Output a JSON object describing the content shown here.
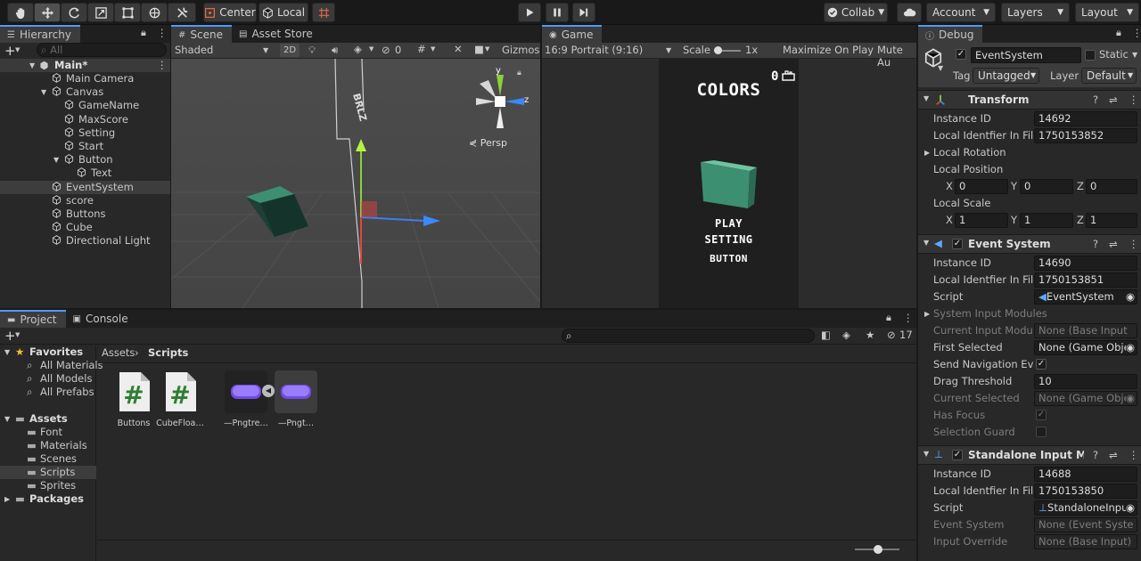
{
  "toolbar": {
    "center_label": "Center",
    "local_label": "Local",
    "collab_label": "Collab",
    "account_label": "Account",
    "layers_label": "Layers",
    "layout_label": "Layout"
  },
  "hierarchy": {
    "tab_label": "Hierarchy",
    "search_placeholder": "All",
    "scene_name": "Main*",
    "items": [
      {
        "label": "Main Camera"
      },
      {
        "label": "Canvas"
      },
      {
        "label": "GameName"
      },
      {
        "label": "MaxScore"
      },
      {
        "label": "Setting"
      },
      {
        "label": "Start"
      },
      {
        "label": "Button"
      },
      {
        "label": "Text"
      },
      {
        "label": "EventSystem"
      },
      {
        "label": "score"
      },
      {
        "label": "Buttons"
      },
      {
        "label": "Cube"
      },
      {
        "label": "Directional Light"
      }
    ]
  },
  "scene": {
    "tab_label": "Scene",
    "asset_store_tab": "Asset Store",
    "shading_mode": "Shaded",
    "mode_2d": "2D",
    "hidden_count": "0",
    "gizmos_label": "Gizmos",
    "persp_label": "Persp",
    "axis_y": "y",
    "axis_z": "z"
  },
  "game": {
    "tab_label": "Game",
    "aspect": "16:9 Portrait (9:16)",
    "scale_label": "Scale",
    "scale_value": "1x",
    "maximize_label": "Maximize On Play",
    "mute_label": "Mute Au",
    "title": "COLORS",
    "score": "0",
    "menu": [
      "PLAY",
      "SETTING",
      "BUTTON"
    ]
  },
  "inspector": {
    "tab_label": "Debug",
    "object_name": "EventSystem",
    "static_label": "Static",
    "tag_label": "Tag",
    "tag_value": "Untagged",
    "layer_label": "Layer",
    "layer_value": "Default",
    "transform": {
      "title": "Transform",
      "instance_id_label": "Instance ID",
      "instance_id": "14692",
      "local_id_label": "Local Identfier In File",
      "local_id": "1750153852",
      "local_rotation_label": "Local Rotation",
      "local_position_label": "Local Position",
      "local_scale_label": "Local Scale",
      "pos_x": "0",
      "pos_y": "0",
      "pos_z": "0",
      "scale_x": "1",
      "scale_y": "1",
      "scale_z": "1",
      "x_label": "X",
      "y_label": "Y",
      "z_label": "Z"
    },
    "event_system": {
      "title": "Event System",
      "instance_id_label": "Instance ID",
      "instance_id": "14690",
      "local_id_label": "Local Identfier In File",
      "local_id": "1750153851",
      "script_label": "Script",
      "script_value": "EventSystem",
      "system_input_label": "System Input Modules",
      "current_input_label": "Current Input Module",
      "current_input_value": "None (Base Input",
      "first_selected_label": "First Selected",
      "first_selected_value": "None (Game Obje",
      "send_nav_label": "Send Navigation Even",
      "drag_threshold_label": "Drag Threshold",
      "drag_threshold_value": "10",
      "current_selected_label": "Current Selected",
      "current_selected_value": "None (Game Obje",
      "has_focus_label": "Has Focus",
      "selection_guard_label": "Selection Guard"
    },
    "standalone": {
      "title": "Standalone Input Module",
      "instance_id_label": "Instance ID",
      "instance_id": "14688",
      "local_id_label": "Local Identfier In File",
      "local_id": "1750153850",
      "script_label": "Script",
      "script_value": "StandaloneInpu",
      "event_system_label": "Event System",
      "event_system_value": "None (Event Syste",
      "input_override_label": "Input Override",
      "input_override_value": "None (Base Input)"
    }
  },
  "project": {
    "tab_label": "Project",
    "console_tab": "Console",
    "hidden_count": "17",
    "favorites_label": "Favorites",
    "favorites": [
      "All Materials",
      "All Models",
      "All Prefabs"
    ],
    "assets_label": "Assets",
    "asset_folders": [
      "Font",
      "Materials",
      "Scenes",
      "Scripts",
      "Sprites"
    ],
    "packages_label": "Packages",
    "breadcrumb_root": "Assets",
    "breadcrumb_current": "Scripts",
    "assets": [
      {
        "name": "Buttons",
        "icon": "csharp-script-icon"
      },
      {
        "name": "CubeFloa…",
        "icon": "csharp-script-icon"
      },
      {
        "name": "—Pngtre…",
        "icon": "sprite-icon"
      },
      {
        "name": "—Pngt…",
        "icon": "sprite-icon"
      }
    ]
  },
  "colors": {
    "accent": "#4d9bff",
    "cube": "#3d8f72",
    "game_bg": "#1f1f1f"
  }
}
